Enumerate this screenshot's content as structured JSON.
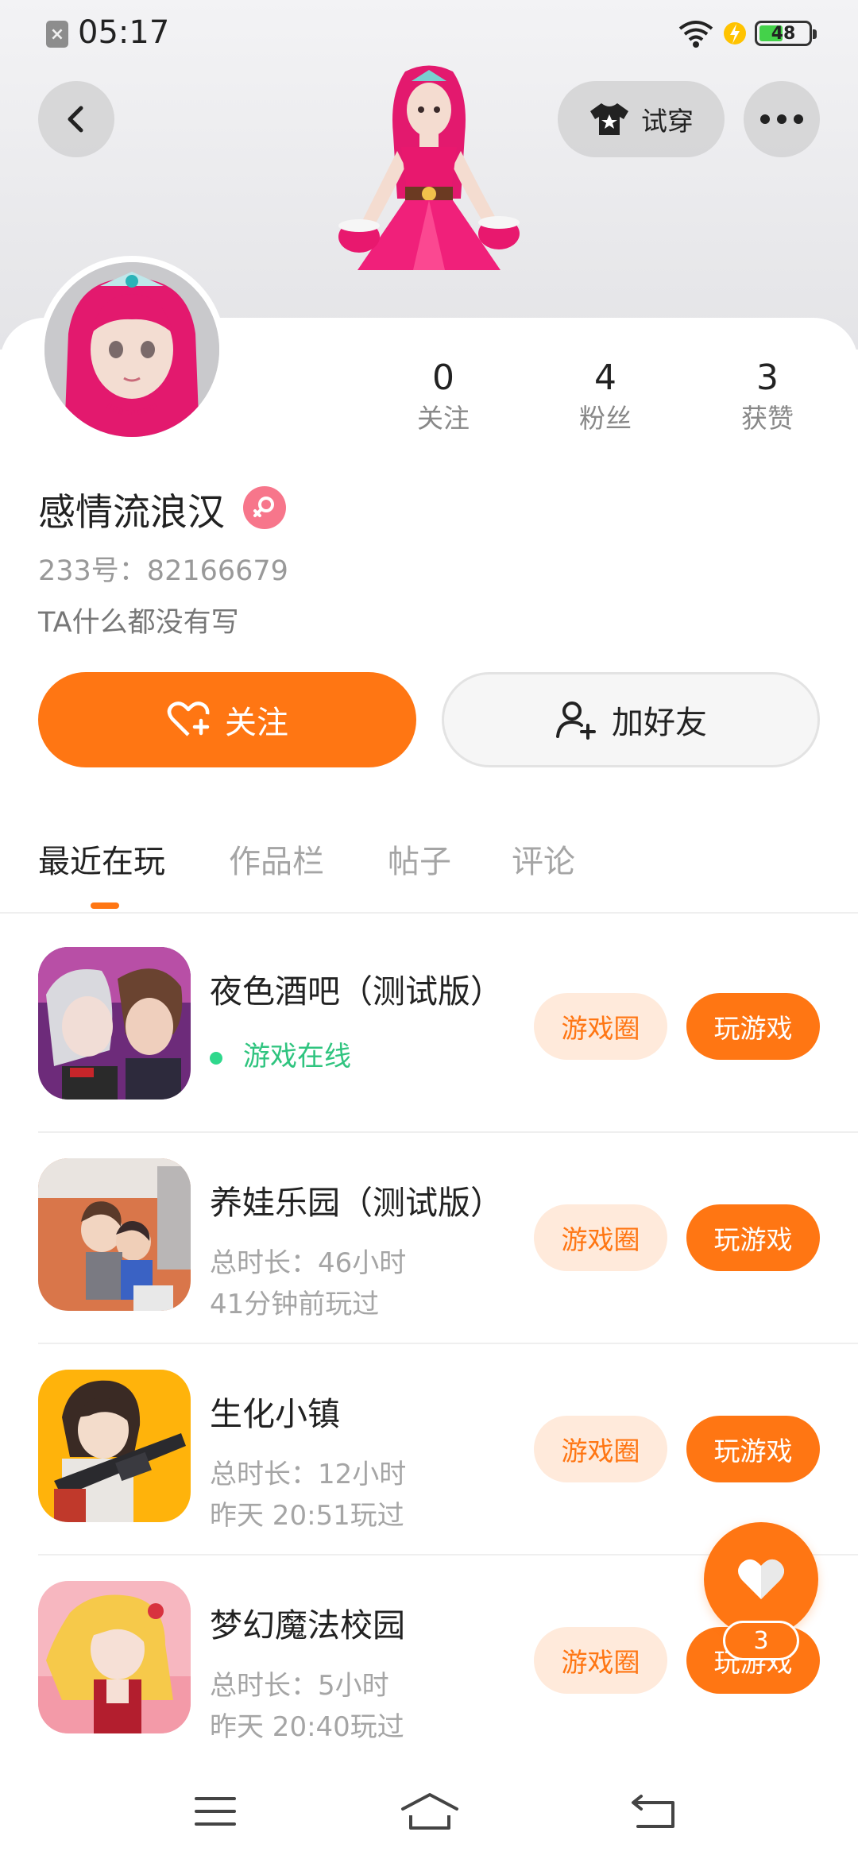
{
  "status_bar": {
    "time": "05:17",
    "battery": "48",
    "battery_level": 0.48
  },
  "header": {
    "tryon_label": "试穿"
  },
  "profile": {
    "stats": [
      {
        "value": "0",
        "label": "关注"
      },
      {
        "value": "4",
        "label": "粉丝"
      },
      {
        "value": "3",
        "label": "获赞"
      }
    ],
    "name": "感情流浪汉",
    "uid": "233号：82166679",
    "bio": "TA什么都没有写",
    "follow_label": "关注",
    "add_friend_label": "加好友"
  },
  "tabs": [
    "最近在玩",
    "作品栏",
    "帖子",
    "评论"
  ],
  "games": [
    {
      "name": "夜色酒吧（测试版）",
      "line1": "游戏在线",
      "line2": "",
      "online": true,
      "circle_label": "游戏圈",
      "play_label": "玩游戏"
    },
    {
      "name": "养娃乐园（测试版）",
      "line1": "总时长：46小时",
      "line2": "41分钟前玩过",
      "online": false,
      "circle_label": "游戏圈",
      "play_label": "玩游戏"
    },
    {
      "name": "生化小镇",
      "line1": "总时长：12小时",
      "line2": "昨天 20:51玩过",
      "online": false,
      "circle_label": "游戏圈",
      "play_label": "玩游戏"
    },
    {
      "name": "梦幻魔法校园",
      "line1": "总时长：5小时",
      "line2": "昨天 20:40玩过",
      "online": false,
      "circle_label": "游戏圈",
      "play_label": "玩游戏"
    }
  ],
  "fab": {
    "count": "3"
  },
  "colors": {
    "accent": "#ff7613",
    "accent_light": "#ffeadb",
    "online": "#2fc47f"
  }
}
